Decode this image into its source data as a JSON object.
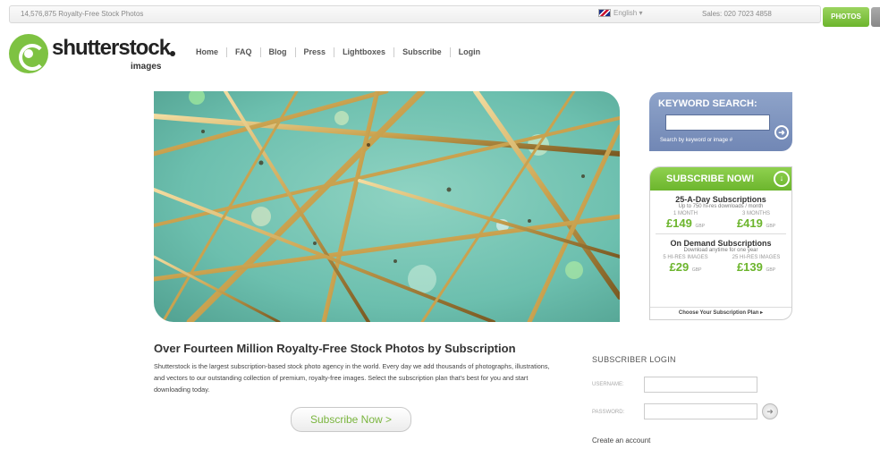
{
  "topbar": {
    "count_text": "14,576,875 Royalty-Free Stock Photos",
    "language": "English ▾",
    "sales": "Sales: 020 7023 4858",
    "photos_tab": "PHOTOS"
  },
  "logo": {
    "name": "shutterstock",
    "sub": "images"
  },
  "nav": {
    "items": [
      "Home",
      "FAQ",
      "Blog",
      "Press",
      "Lightboxes",
      "Subscribe",
      "Login"
    ]
  },
  "keyword_search": {
    "title": "KEYWORD SEARCH:",
    "placeholder": "",
    "hint": "Search by keyword or image #"
  },
  "subscribe_box": {
    "title": "SUBSCRIBE NOW!",
    "plan1": {
      "title": "25-A-Day Subscriptions",
      "subtitle": "Up to 750 hi-res downloads / month",
      "opt1_label": "1 MONTH",
      "opt1_price": "£149",
      "opt1_unit": "GBP",
      "opt2_label": "3 MONTHS",
      "opt2_price": "£419",
      "opt2_unit": "GBP"
    },
    "plan2": {
      "title": "On Demand Subscriptions",
      "subtitle": "Download anytime for one year",
      "opt1_label": "5 HI-RES IMAGES",
      "opt1_price": "£29",
      "opt1_unit": "GBP",
      "opt2_label": "25 HI-RES IMAGES",
      "opt2_price": "£139",
      "opt2_unit": "GBP"
    },
    "footer": "Choose Your Subscription Plan ▸"
  },
  "main": {
    "headline": "Over Fourteen Million Royalty-Free Stock Photos by Subscription",
    "description": "Shutterstock is the largest subscription-based stock photo agency in the world. Every day we add thousands of photographs, illustrations, and vectors to our outstanding collection of premium, royalty-free images. Select the subscription plan that's best for you and start downloading today.",
    "cta": "Subscribe Now >"
  },
  "login": {
    "title": "SUBSCRIBER LOGIN",
    "username_label": "USERNAME:",
    "password_label": "PASSWORD:",
    "create_account": "Create an account"
  },
  "colors": {
    "brand_green": "#7ec242",
    "search_blue": "#7f95c0",
    "hero_teal": "#6fc2b0"
  }
}
